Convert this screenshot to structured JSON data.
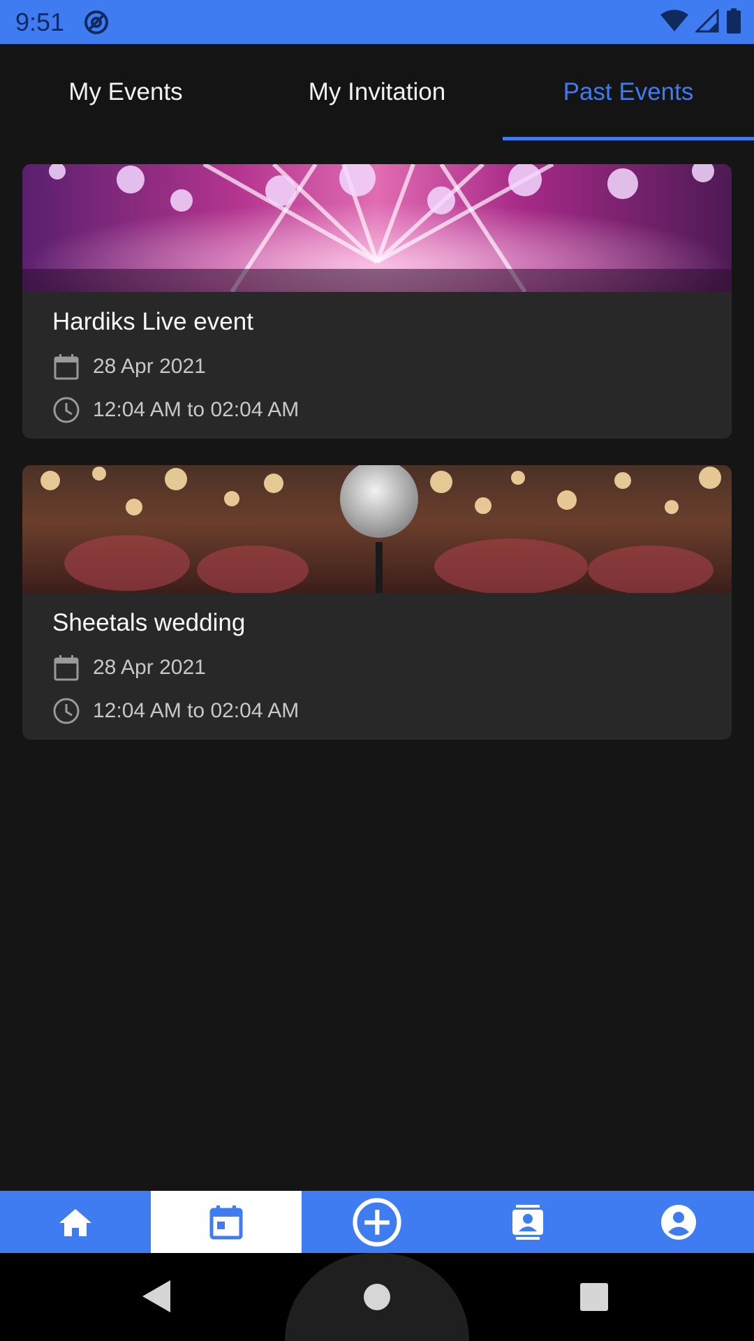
{
  "status_bar": {
    "time": "9:51",
    "background_color": "#3f7bf1",
    "icons": [
      "at-sign-icon",
      "wifi-icon",
      "signal-icon",
      "battery-icon"
    ]
  },
  "tabs": [
    {
      "label": "My Events",
      "active": false
    },
    {
      "label": "My Invitation",
      "active": false
    },
    {
      "label": "Past Events",
      "active": true
    }
  ],
  "events": [
    {
      "title": "Hardiks Live event",
      "date": "28 Apr 2021",
      "time": "12:04 AM to 02:04 AM",
      "image": "concert-stage-lights"
    },
    {
      "title": "Sheetals wedding",
      "date": "28 Apr 2021",
      "time": "12:04 AM to 02:04 AM",
      "image": "microphone-bokeh-crowd"
    }
  ],
  "bottom_nav": [
    {
      "icon": "home-icon",
      "active": false
    },
    {
      "icon": "calendar-icon",
      "active": true
    },
    {
      "icon": "add-circle-icon",
      "active": false
    },
    {
      "icon": "contacts-icon",
      "active": false
    },
    {
      "icon": "account-icon",
      "active": false
    }
  ],
  "colors": {
    "accent": "#3f7bf1",
    "background": "#151515",
    "card": "#282828"
  }
}
